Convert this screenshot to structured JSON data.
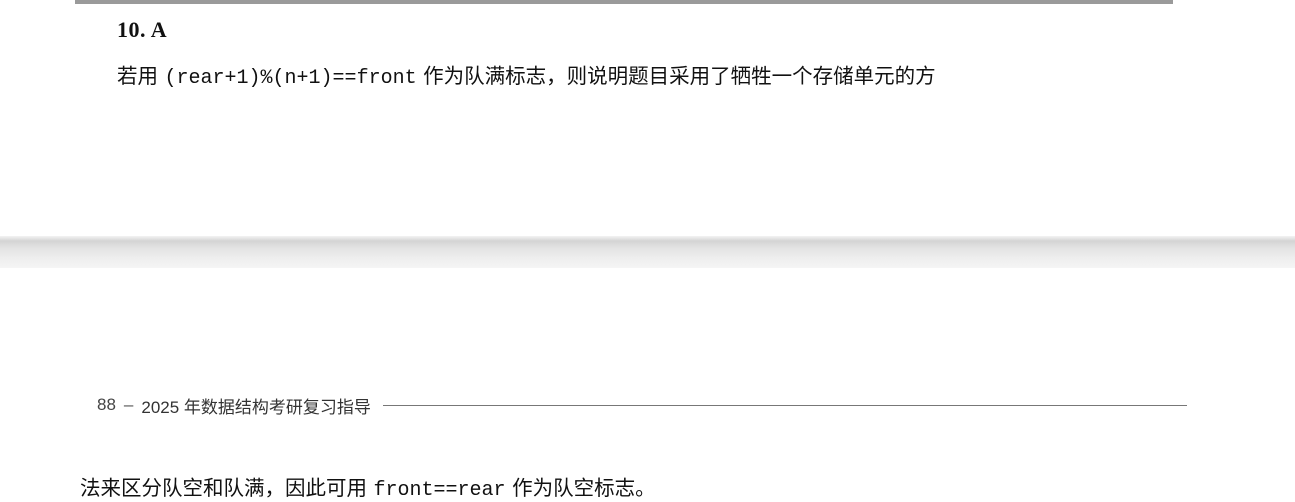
{
  "page_top": {
    "answer_heading": "10. A",
    "line1": {
      "prefix": "若用",
      "code": "(rear+1)%(n+1)==front",
      "suffix": "作为队满标志，则说明题目采用了牺牲一个存储单元的方"
    }
  },
  "footer": {
    "page_number": "88",
    "dash": "–",
    "book_title": "2025 年数据结构考研复习指导"
  },
  "page_bottom": {
    "line2": {
      "prefix": "法来区分队空和队满，因此可用",
      "code": "front==rear",
      "suffix": "作为队空标志。"
    }
  }
}
